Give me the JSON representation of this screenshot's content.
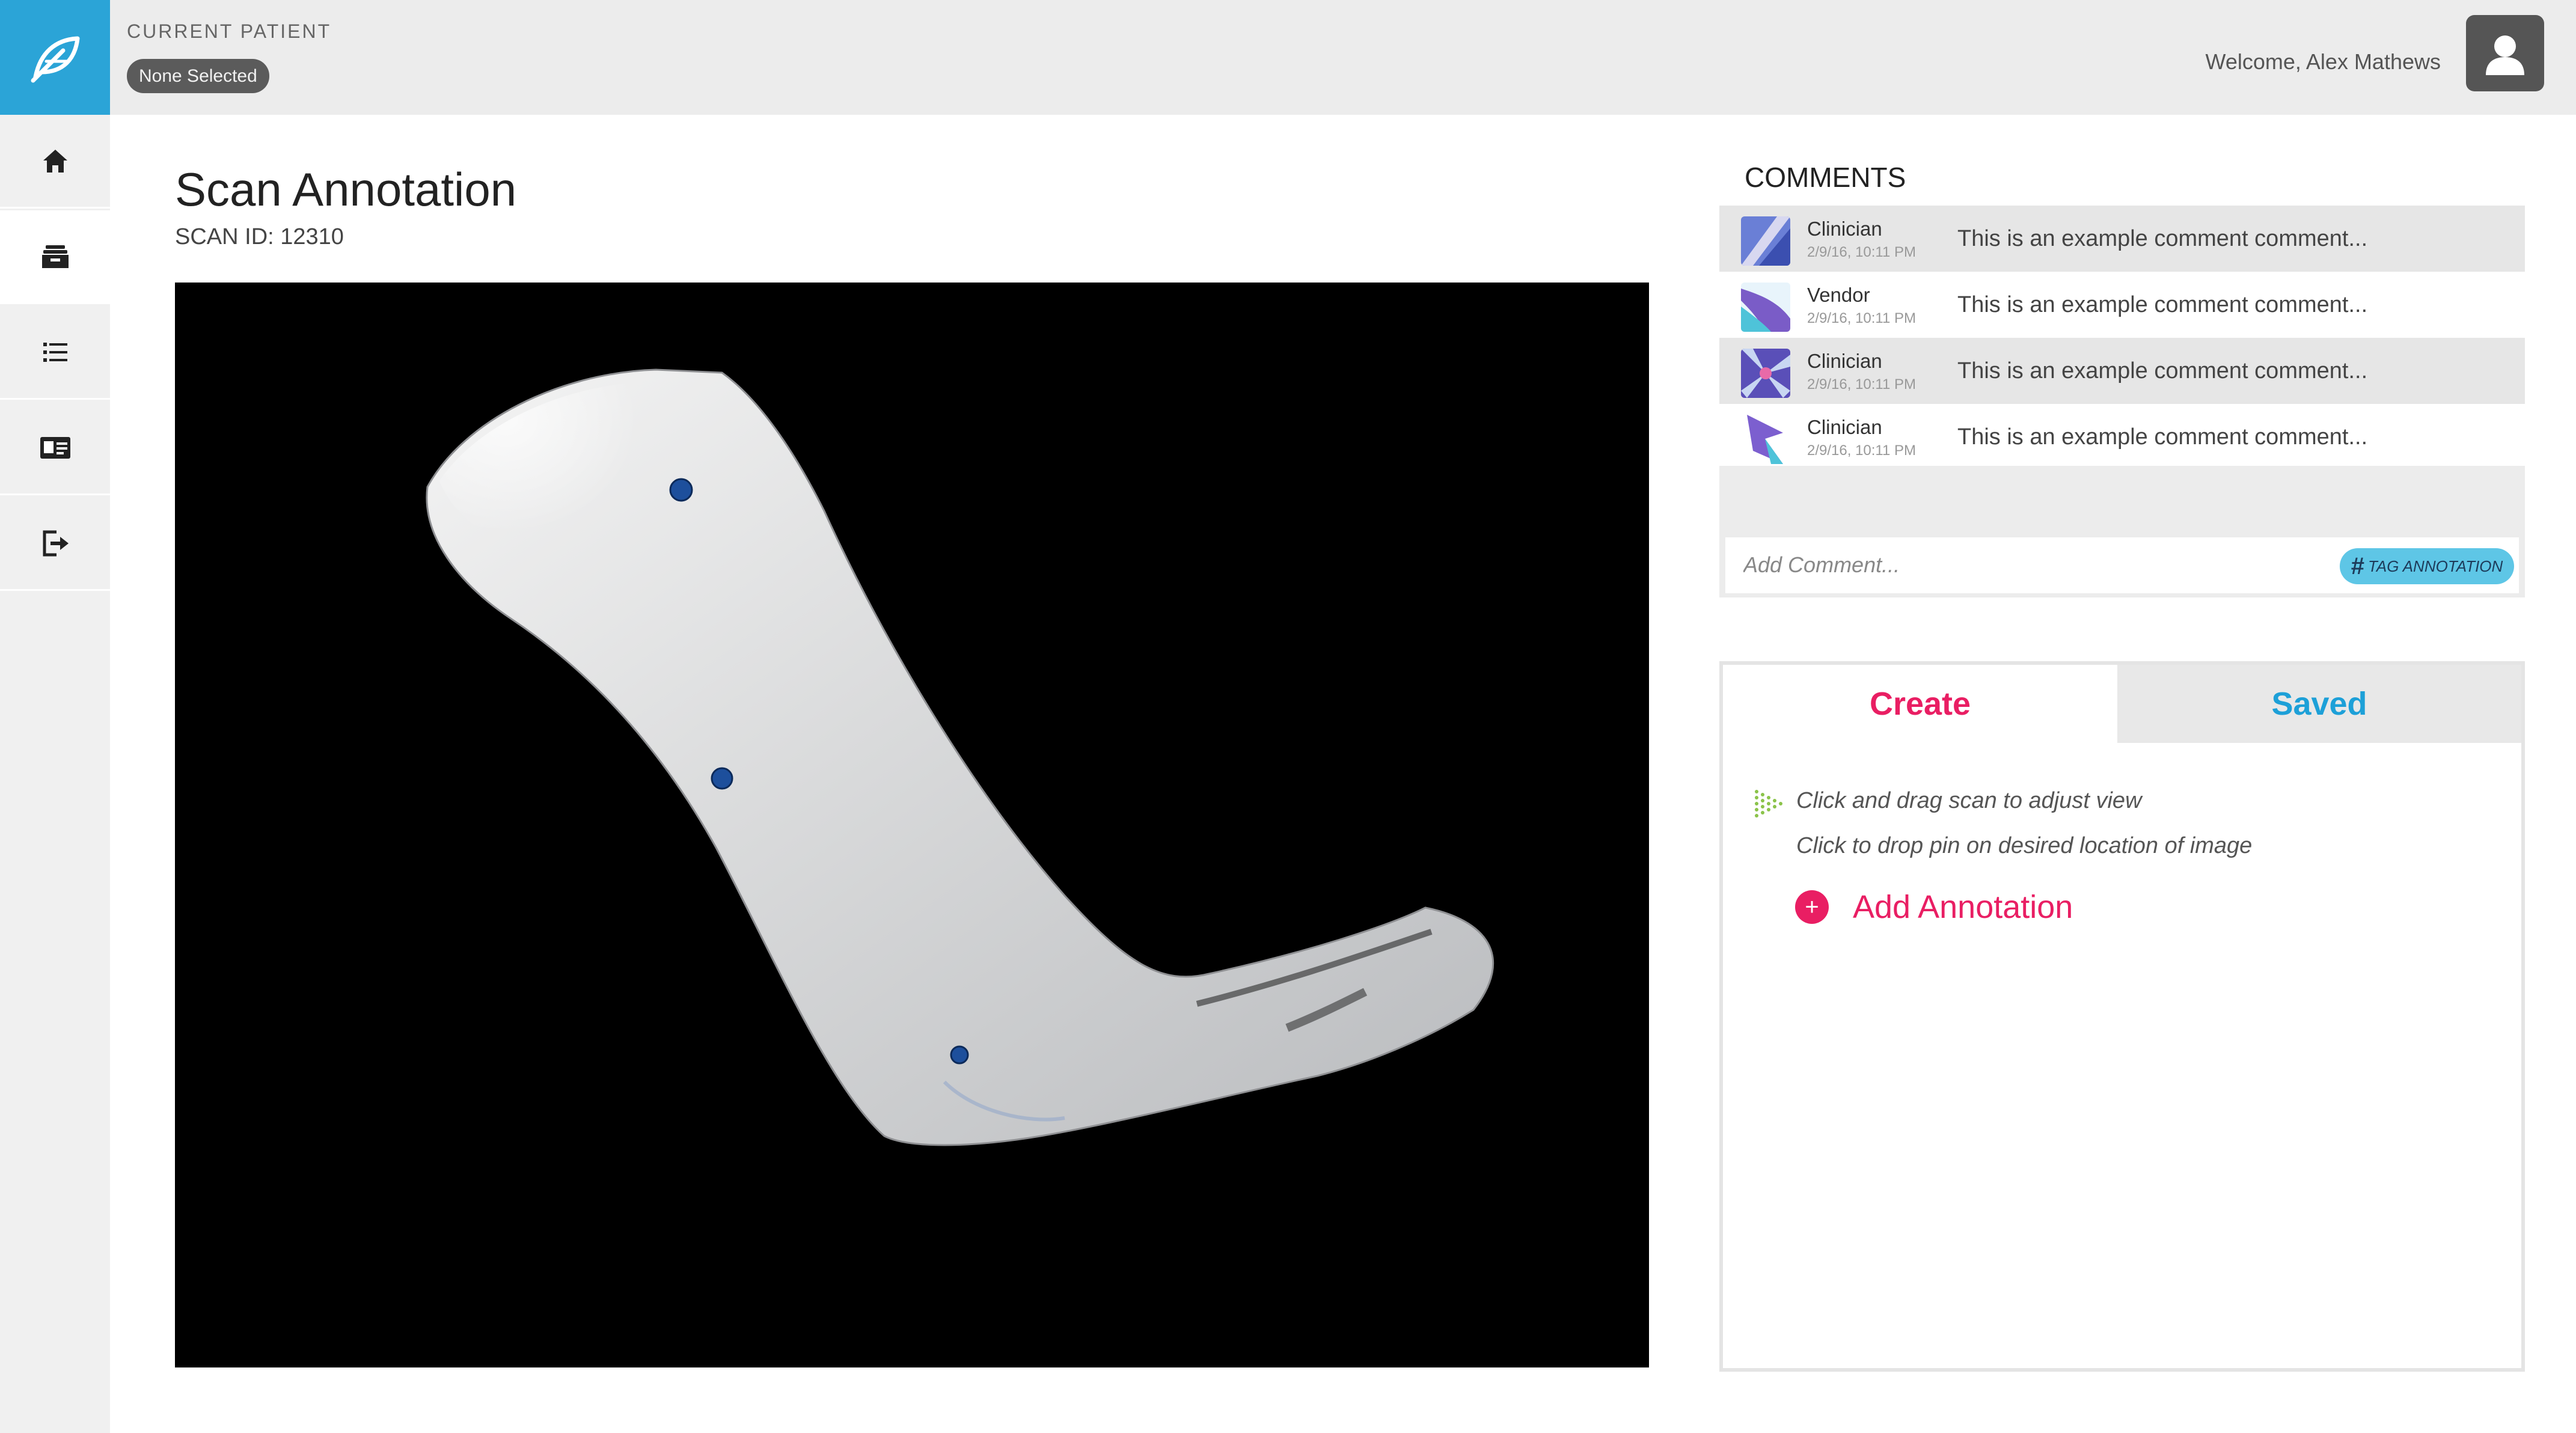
{
  "header": {
    "current_patient_label": "CURRENT PATIENT",
    "patient_value": "None Selected",
    "welcome_text": "Welcome, Alex Mathews",
    "brand_color": "#2ba4d7"
  },
  "sidebar": {
    "items": [
      {
        "icon": "home-icon",
        "active": false
      },
      {
        "icon": "inbox-icon",
        "active": true
      },
      {
        "icon": "list-icon",
        "active": false
      },
      {
        "icon": "id-card-icon",
        "active": false
      },
      {
        "icon": "logout-icon",
        "active": false
      }
    ]
  },
  "main": {
    "title": "Scan Annotation",
    "scan_id": "SCAN ID: 12310",
    "viewer": {
      "pins": 3
    }
  },
  "comments": {
    "title": "COMMENTS",
    "items": [
      {
        "author": "Clinician",
        "time": "2/9/16, 10:11 PM",
        "text": "This is an example comment comment..."
      },
      {
        "author": "Vendor",
        "time": "2/9/16, 10:11 PM",
        "text": "This is an example comment comment..."
      },
      {
        "author": "Clinician",
        "time": "2/9/16, 10:11 PM",
        "text": "This is an example comment comment..."
      },
      {
        "author": "Clinician",
        "time": "2/9/16, 10:11 PM",
        "text": "This is an example comment comment..."
      }
    ],
    "input_placeholder": "Add Comment...",
    "tag_button": "TAG ANNOTATION"
  },
  "panel": {
    "tabs": [
      {
        "label": "Create",
        "active": true
      },
      {
        "label": "Saved",
        "active": false
      }
    ],
    "instruction_1": "Click and drag scan to adjust view",
    "instruction_2": "Click to drop pin on desired location of image",
    "add_annotation": "Add Annotation",
    "accent_color": "#e91e63",
    "secondary_color": "#1da0d8"
  }
}
